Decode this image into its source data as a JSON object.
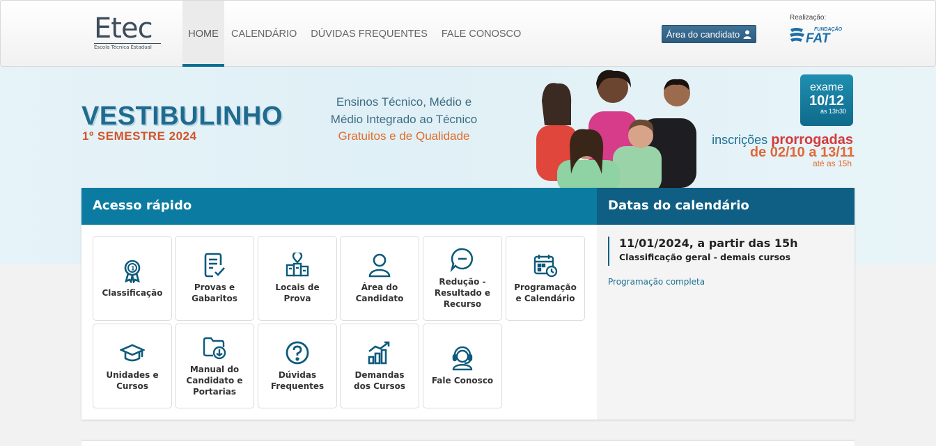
{
  "header": {
    "logo_main": "Etec",
    "logo_sub": "Escola Técnica Estadual",
    "nav": [
      "HOME",
      "CALENDÁRIO",
      "DÚVIDAS FREQUENTES",
      "FALE CONOSCO"
    ],
    "candidate_button": "Área do candidato",
    "realizacao": "Realização:",
    "fat_small": "FUNDAÇÃO",
    "fat_big": "FAT"
  },
  "banner": {
    "title": "VESTIBULINHO",
    "semester": "1º SEMESTRE 2024",
    "line1": "Ensinos Técnico, Médio e",
    "line2": "Médio Integrado ao Técnico",
    "line3": "Gratuitos e de Qualidade",
    "exam_word": "exame",
    "exam_date": "10/12",
    "exam_time": "às 13h30",
    "insc_a": "inscrições",
    "insc_b": "prorrogadas",
    "insc_dates": "de 02/10 a 13/11",
    "insc_time": "até as 15h"
  },
  "acesso": {
    "title": "Acesso rápido",
    "tiles": [
      {
        "label": "Classificação",
        "icon": "award-icon"
      },
      {
        "label": "Provas e\nGabaritos",
        "icon": "document-check-icon"
      },
      {
        "label": "Locais de\nProva",
        "icon": "map-building-icon"
      },
      {
        "label": "Área do\nCandidato",
        "icon": "user-icon"
      },
      {
        "label": "Redução -\nResultado e\nRecurso",
        "icon": "chat-minus-icon"
      },
      {
        "label": "Programação\ne Calendário",
        "icon": "calendar-clock-icon"
      },
      {
        "label": "Unidades e\nCursos",
        "icon": "graduation-cap-icon"
      },
      {
        "label": "Manual do\nCandidato e\nPortarias",
        "icon": "folder-download-icon"
      },
      {
        "label": "Dúvidas\nFrequentes",
        "icon": "question-icon"
      },
      {
        "label": "Demandas\ndos Cursos",
        "icon": "chart-growth-icon"
      },
      {
        "label": "Fale Conosco",
        "icon": "headset-icon"
      }
    ]
  },
  "calendario": {
    "title": "Datas do calendário",
    "date": "11/01/2024, a partir das 15h",
    "description": "Classificação geral - demais cursos",
    "link": "Programação completa"
  },
  "colors": {
    "accent": "#0b7ba1",
    "accent_dark": "#0e5f83",
    "icon": "#0d5a7c",
    "orange": "#e36b2a"
  }
}
